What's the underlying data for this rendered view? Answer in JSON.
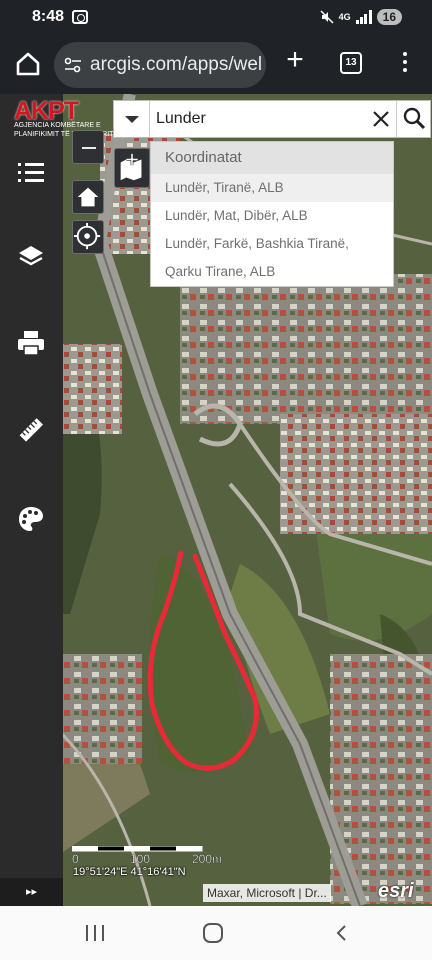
{
  "status_bar": {
    "time": "8:48",
    "network": "4G",
    "battery": "16"
  },
  "browser": {
    "url": "arcgis.com/apps/wel",
    "tab_count": "13"
  },
  "logo": {
    "name": "AKPT",
    "subtitle_line1": "AGJENCIA KOMBËTARE E",
    "subtitle_line2": "PLANIFIKIMIT TË TERRITORIT"
  },
  "sidebar": {
    "tools": [
      {
        "icon": "list-icon"
      },
      {
        "icon": "layers-icon"
      },
      {
        "icon": "print-icon"
      },
      {
        "icon": "measure-icon"
      },
      {
        "icon": "palette-icon"
      }
    ],
    "expand_label": "▸▸"
  },
  "search": {
    "value": "Lunder",
    "suggestions_header": "Koordinatat",
    "suggestions": [
      {
        "label": "Lundër, Tiranë, ALB",
        "selected": true
      },
      {
        "label": "Lundër, Mat, Dibër, ALB",
        "selected": false
      },
      {
        "label": "Lundër, Farkë, Bashkia Tiranë,",
        "selected": false
      },
      {
        "label": "Qarku Tirane, ALB",
        "selected": false
      }
    ]
  },
  "map": {
    "scale_labels": [
      "0",
      "100",
      "200m"
    ],
    "coordinates": "19°51'24\"E 41°16'41\"N",
    "attribution": "Maxar, Microsoft | Dr...",
    "esri": "esri",
    "highlight_color": "#e82a37"
  }
}
